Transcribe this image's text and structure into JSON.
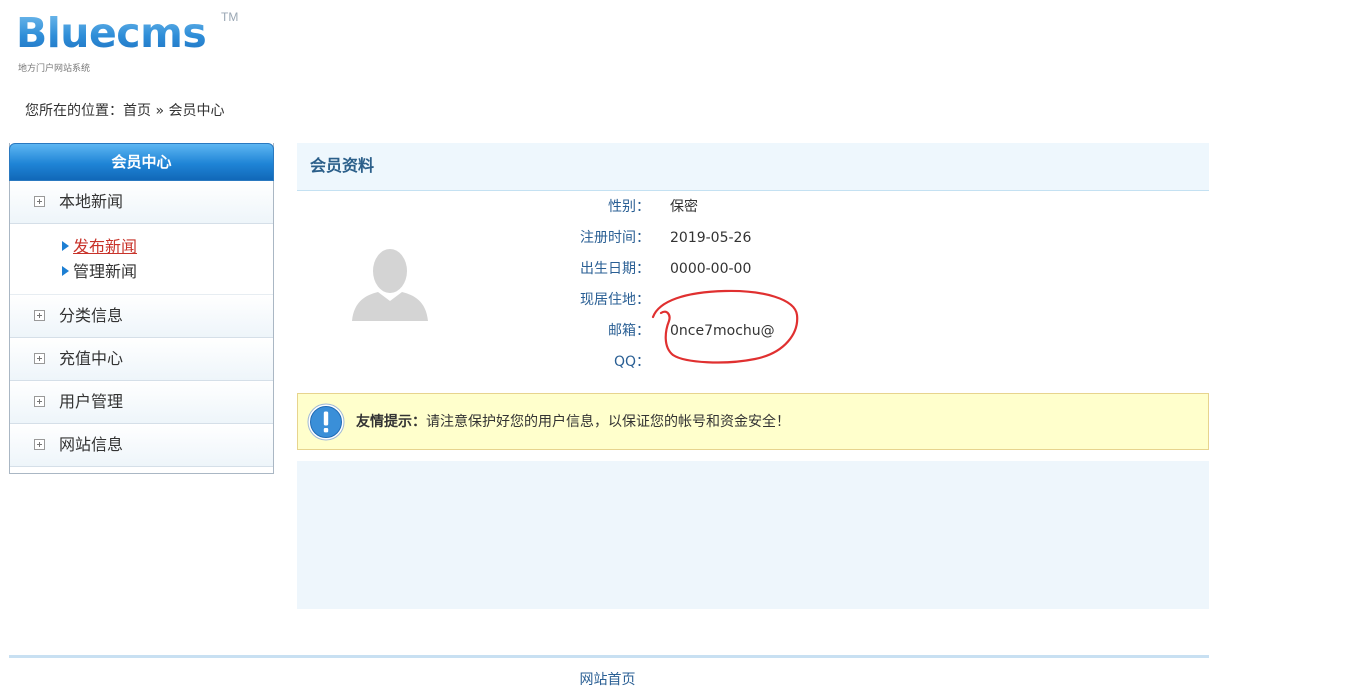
{
  "logo": {
    "brand": "Bluecms",
    "trademark": "TM",
    "tagline": "地方门户网站系统"
  },
  "breadcrumb": {
    "prefix": "您所在的位置：",
    "home": "首页",
    "separator": " » ",
    "current": "会员中心"
  },
  "sidebar": {
    "title": "会员中心",
    "groups": [
      {
        "label": "本地新闻",
        "icon": "plus-square-icon"
      },
      {
        "label": "分类信息",
        "icon": "plus-square-icon"
      },
      {
        "label": "充值中心",
        "icon": "plus-square-icon"
      },
      {
        "label": "用户管理",
        "icon": "plus-square-icon"
      },
      {
        "label": "网站信息",
        "icon": "plus-square-icon"
      }
    ],
    "sub_items": [
      {
        "label": "发布新闻",
        "active": true,
        "icon": "arrow-right-icon"
      },
      {
        "label": "管理新闻",
        "active": false,
        "icon": "arrow-right-icon"
      }
    ]
  },
  "profile": {
    "title": "会员资料",
    "avatar_icon": "default-avatar-icon",
    "fields": [
      {
        "label": "性别：",
        "value": "保密"
      },
      {
        "label": "注册时间：",
        "value": "2019-05-26"
      },
      {
        "label": "出生日期：",
        "value": "0000-00-00"
      },
      {
        "label": "现居住地：",
        "value": ""
      },
      {
        "label": "邮箱：",
        "value": "0nce7mochu@"
      },
      {
        "label": "QQ：",
        "value": ""
      }
    ]
  },
  "tip": {
    "icon": "info-icon",
    "bold": "友情提示：",
    "text": "请注意保护好您的用户信息，以保证您的帐号和资金安全！"
  },
  "footer": {
    "link": "网站首页"
  },
  "colors": {
    "accent_blue": "#1f84d6",
    "label_blue": "#2a5f94",
    "active_red": "#c8332a",
    "annotation_red": "#e03030",
    "tip_bg": "#ffffcc"
  }
}
